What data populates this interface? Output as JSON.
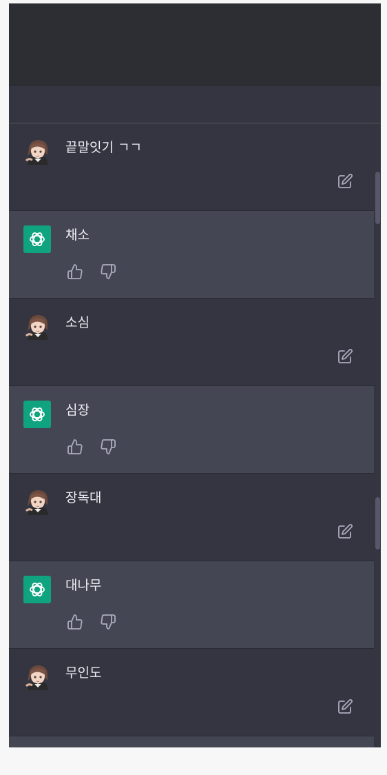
{
  "conversation": {
    "messages": [
      {
        "role": "user",
        "text": "끝말잇기 ㄱㄱ"
      },
      {
        "role": "assistant",
        "text": "채소"
      },
      {
        "role": "user",
        "text": "소심"
      },
      {
        "role": "assistant",
        "text": "심장"
      },
      {
        "role": "user",
        "text": "장독대"
      },
      {
        "role": "assistant",
        "text": "대나무"
      },
      {
        "role": "user",
        "text": "무인도"
      }
    ]
  },
  "icons": {
    "user_avatar": "anime-avatar-icon",
    "assistant_avatar": "openai-logo-icon",
    "edit": "edit-icon",
    "thumbs_up": "thumbs-up-icon",
    "thumbs_down": "thumbs-down-icon"
  },
  "colors": {
    "user_bg": "#343541",
    "assistant_bg": "#444654",
    "assistant_avatar_bg": "#10a37f",
    "text": "#ececf1",
    "icon": "#acacbe"
  }
}
